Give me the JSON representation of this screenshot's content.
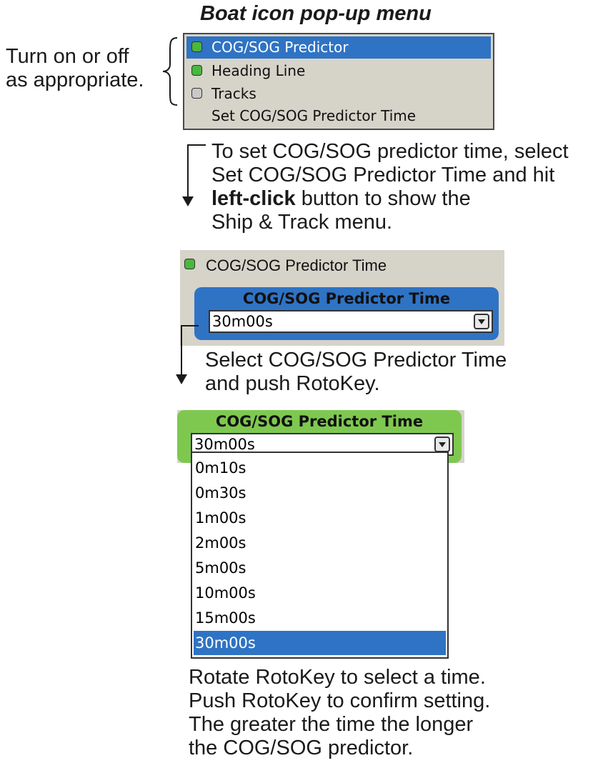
{
  "title": "Boat icon pop-up menu",
  "side_note": [
    "Turn on or off",
    "as appropriate."
  ],
  "menu": {
    "items": [
      {
        "label": "COG/SOG Predictor",
        "state": "on",
        "selected": true
      },
      {
        "label": "Heading Line",
        "state": "on",
        "selected": false
      },
      {
        "label": "Tracks",
        "state": "off",
        "selected": false
      },
      {
        "label": "Set COG/SOG Predictor Time",
        "state": "none",
        "selected": false
      }
    ]
  },
  "step1": {
    "line1": "To set COG/SOG predictor time, select",
    "line2": "Set COG/SOG Predictor Time and hit",
    "bold": "left-click",
    "line3_rest": " button to show the",
    "line4": "Ship & Track menu."
  },
  "ship_track": {
    "item_label": "COG/SOG Predictor Time",
    "box_label": "COG/SOG Predictor Time",
    "value": "30m00s"
  },
  "step2": {
    "line1": "Select COG/SOG Predictor Time",
    "line2": "and push RotoKey."
  },
  "dropdown": {
    "box_label": "COG/SOG Predictor Time",
    "value": "30m00s",
    "options": [
      "0m10s",
      "0m30s",
      "1m00s",
      "2m00s",
      "5m00s",
      "10m00s",
      "15m00s",
      "30m00s"
    ],
    "selected": "30m00s"
  },
  "step3": [
    "Rotate RotoKey to select a time.",
    "Push RotoKey to confirm setting.",
    "The greater the time the longer",
    "the COG/SOG predictor."
  ],
  "colors": {
    "highlight": "#2f73c4",
    "led_on": "#49b83e",
    "led_off": "#c9c9c9",
    "frame_blue": "#2f73c4",
    "frame_green": "#7ec850",
    "panel": "#d6d3c9"
  }
}
